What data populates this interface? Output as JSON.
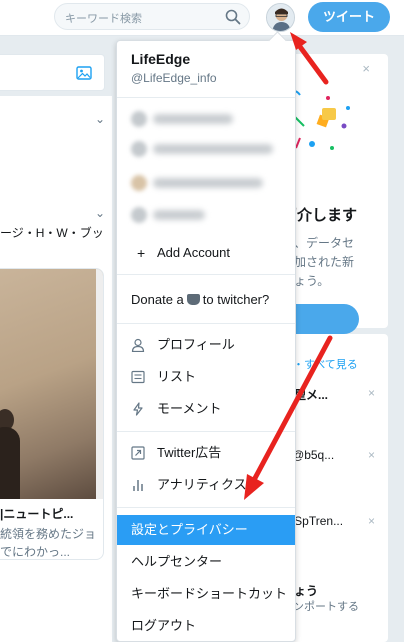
{
  "header": {
    "search_placeholder": "キーワード検索",
    "tweet_button": "ツイート"
  },
  "timeline": {
    "card2_name_fragment": "ージ・H・W・ブッ",
    "media": {
      "title_fragment": "|ニュートピ...",
      "desc_line1": "統領を務めたジョ",
      "desc_line2": "でにわかっ..."
    }
  },
  "menu": {
    "account_name": "LifeEdge",
    "account_handle": "@LifeEdge_info",
    "add_account": "Add Account",
    "donate_prefix": "Donate a",
    "donate_suffix": "to twitcher?",
    "items_group1": [
      {
        "label": "プロフィール",
        "icon": "person-icon"
      },
      {
        "label": "リスト",
        "icon": "list-icon"
      },
      {
        "label": "モーメント",
        "icon": "lightning-icon"
      }
    ],
    "items_group2": [
      {
        "label": "Twitter広告",
        "icon": "external-link-icon"
      },
      {
        "label": "アナリティクス",
        "icon": "bar-chart-icon"
      }
    ],
    "items_group3": [
      {
        "label": "設定とプライバシー"
      },
      {
        "label": "ヘルプセンター"
      },
      {
        "label": "キーボードショートカット"
      },
      {
        "label": "ログアウト"
      }
    ],
    "active_item": "設定とプライバシー"
  },
  "sidebar": {
    "promo": {
      "close": "×",
      "title_fragment": "紹介します",
      "desc_line1": "ス、データセ",
      "desc_line2": "追加された新",
      "desc_line3": "しょう。"
    },
    "trends": {
      "header": "新・すべて見る",
      "rows": [
        {
          "text": "検型メ...",
          "close": "×"
        },
        {
          "text": "3 @b5q...",
          "close": "×"
        },
        {
          "text": "@SpTren...",
          "close": "×"
        }
      ],
      "follow_title": "しょう",
      "follow_sub": "インポートする"
    }
  },
  "colors": {
    "accent": "#1da1f2",
    "tweet_button": "#4aa8eb",
    "active_item": "#2a9df4",
    "annotation_arrow": "#e8231f"
  }
}
